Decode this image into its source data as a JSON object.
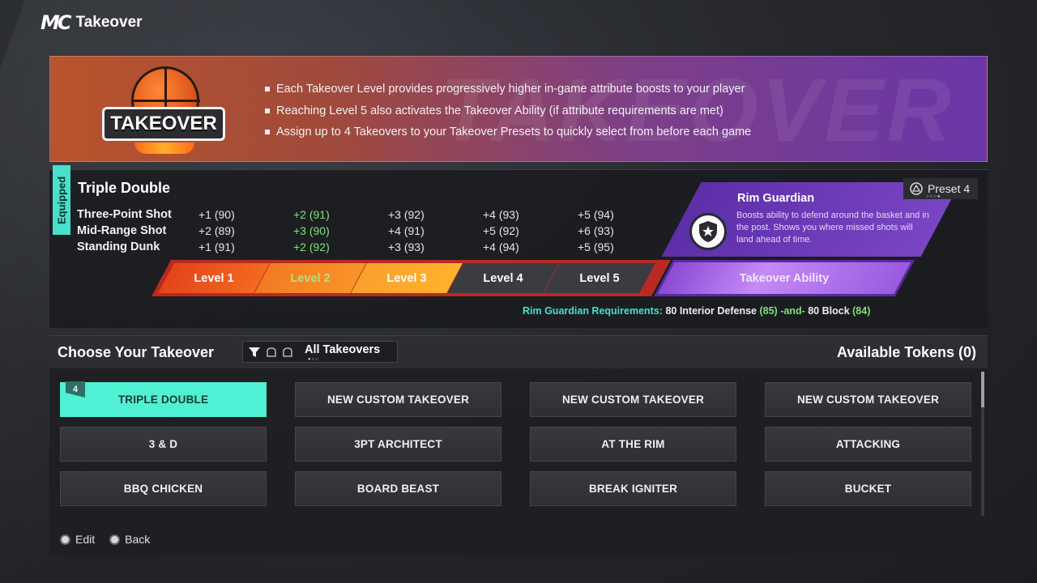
{
  "header": {
    "logo": "MC",
    "title": "Takeover"
  },
  "banner": {
    "logo_text": "TAKEOVER",
    "bg_word": "TAKEOVER",
    "bullets": [
      "Each Takeover Level provides progressively higher in-game attribute boosts to your player",
      "Reaching Level 5 also activates the Takeover Ability (if attribute requirements are met)",
      "Assign up to 4 Takeovers to your Takeover Presets to quickly select from before each game"
    ]
  },
  "equipped": {
    "tab_label": "Equipped",
    "name": "Triple Double",
    "preset_label": "Preset 4",
    "attributes": [
      {
        "name": "Three-Point Shot",
        "values": [
          "+1 (90)",
          "+2 (91)",
          "+3 (92)",
          "+4 (93)",
          "+5 (94)"
        ]
      },
      {
        "name": "Mid-Range Shot",
        "values": [
          "+2 (89)",
          "+3 (90)",
          "+4 (91)",
          "+5 (92)",
          "+6 (93)"
        ]
      },
      {
        "name": "Standing Dunk",
        "values": [
          "+1 (91)",
          "+2 (92)",
          "+3 (93)",
          "+4 (94)",
          "+5 (95)"
        ]
      }
    ],
    "levels": [
      "Level 1",
      "Level 2",
      "Level 3",
      "Level 4",
      "Level 5"
    ],
    "ability_bar_label": "Takeover Ability",
    "ability": {
      "title": "Rim Guardian",
      "description": "Boosts ability to defend around the basket and in the post. Shows you where missed shots will land ahead of time."
    },
    "requirements": {
      "label": "Rim Guardian Requirements:",
      "req1": "80 Interior Defense",
      "req1_current": "(85)",
      "joiner": "-and-",
      "req2": "80 Block",
      "req2_current": "(84)"
    }
  },
  "choose": {
    "title": "Choose Your Takeover",
    "filter_label": "All Takeovers",
    "tokens_label": "Available Tokens (0)",
    "selected_badge": "4",
    "tiles": [
      "TRIPLE DOUBLE",
      "NEW CUSTOM TAKEOVER",
      "NEW CUSTOM TAKEOVER",
      "NEW CUSTOM TAKEOVER",
      "3 & D",
      "3PT ARCHITECT",
      "AT THE RIM",
      "ATTACKING",
      "BBQ CHICKEN",
      "BOARD BEAST",
      "BREAK IGNITER",
      "BUCKET"
    ]
  },
  "footer": {
    "edit_label": "Edit",
    "back_label": "Back"
  },
  "colors": {
    "accent_teal": "#4ff0d4",
    "ability_purple": "#7a45c4",
    "level_orange": "#f26a20"
  }
}
